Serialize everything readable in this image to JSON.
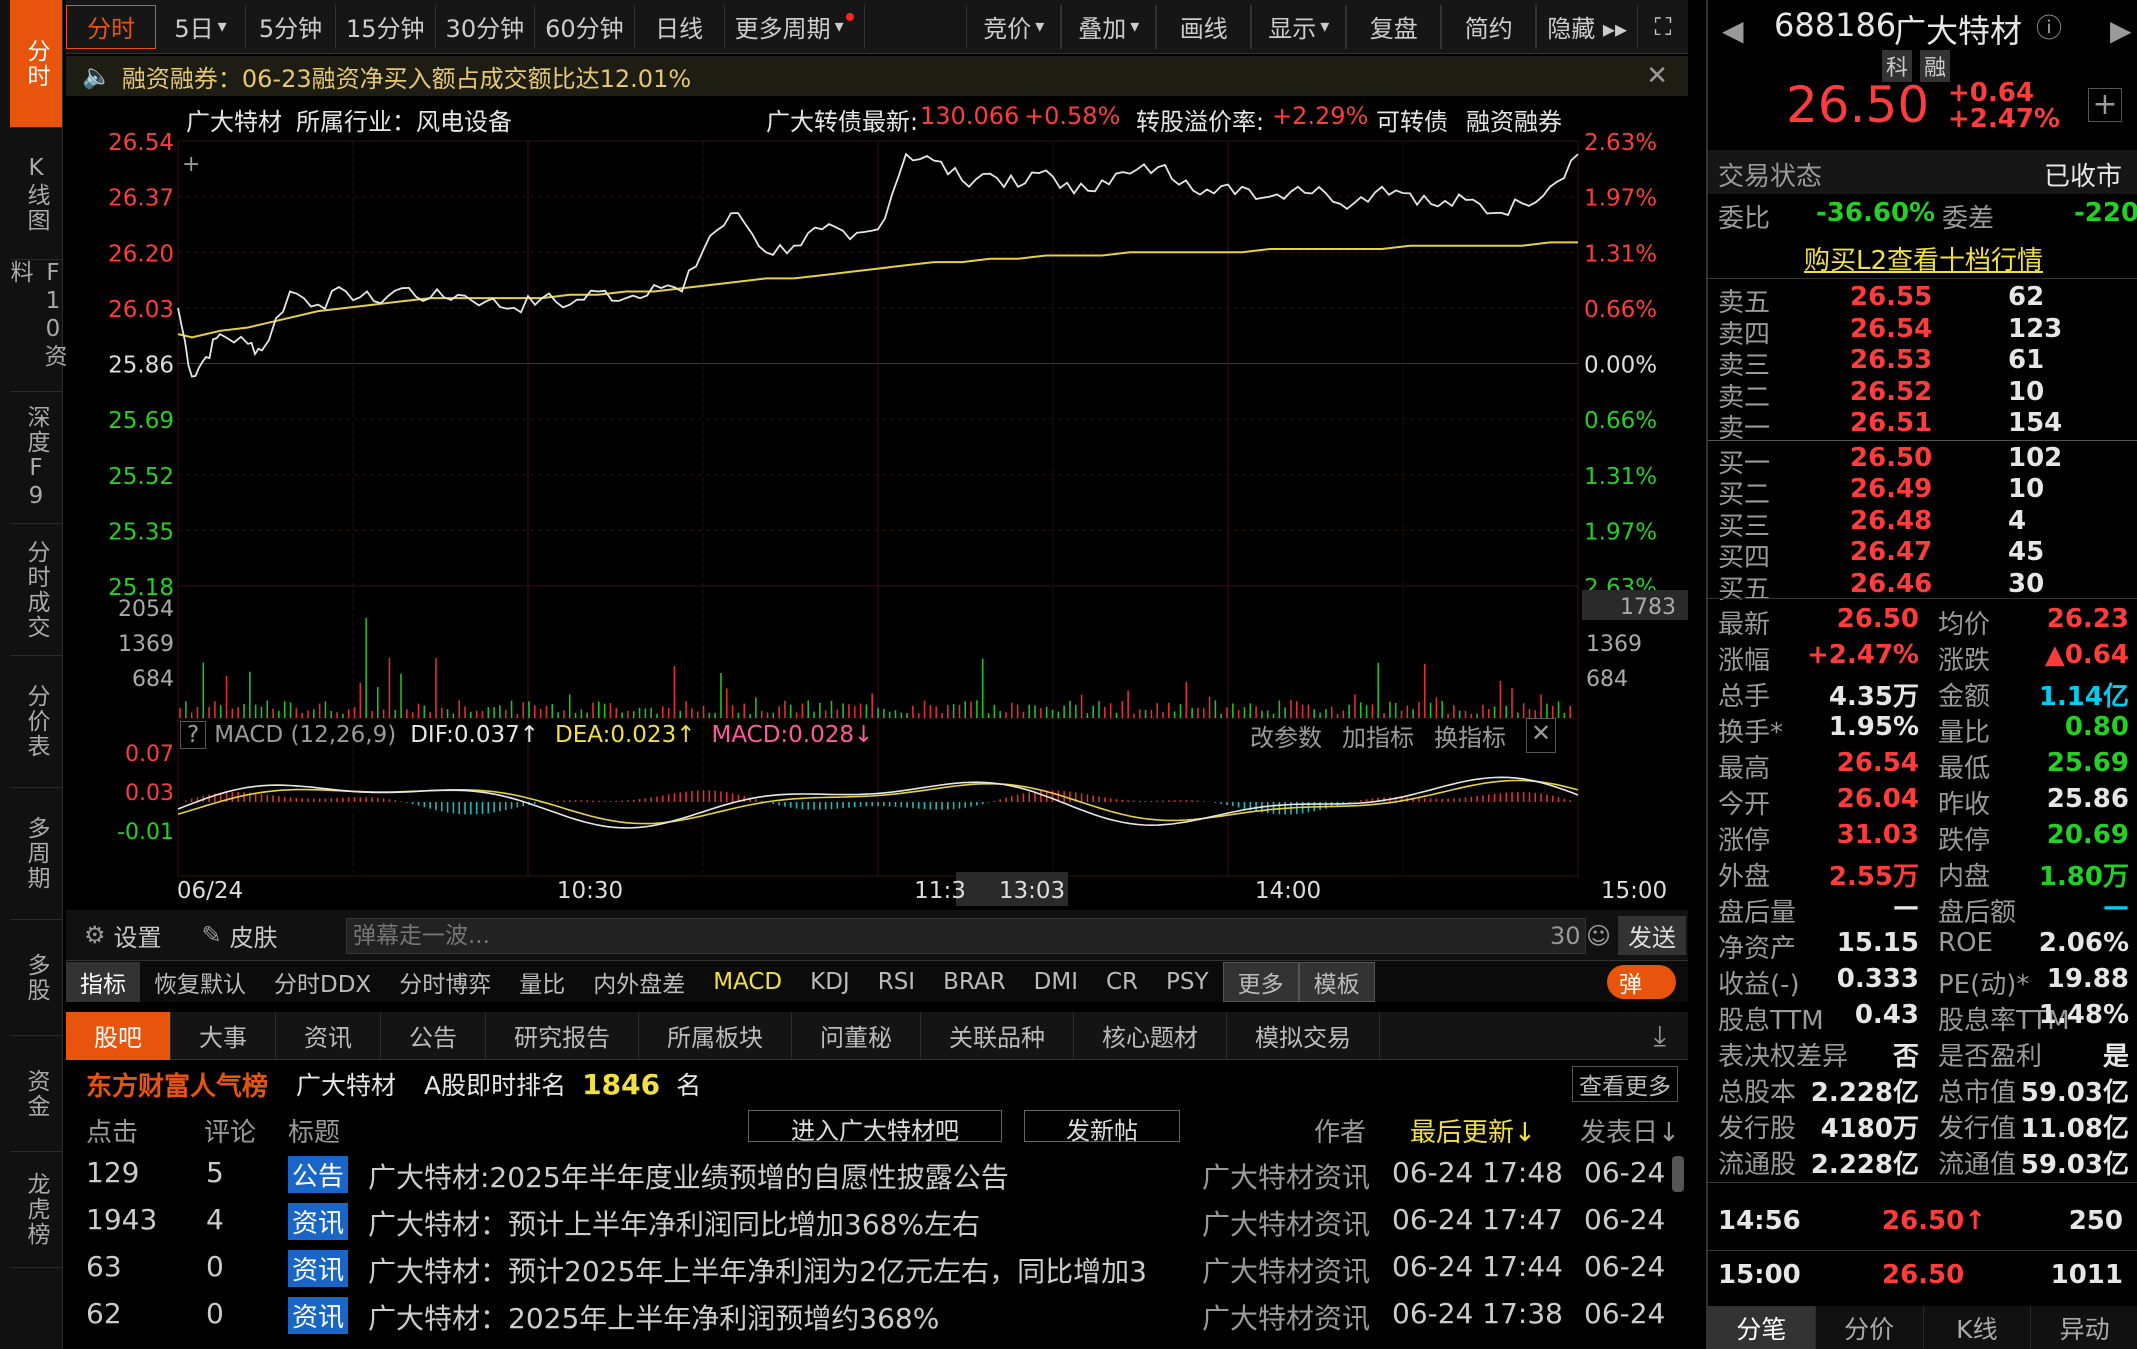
{
  "sidebar": {
    "items": [
      "分时",
      "K线图",
      "F10资料",
      "深度F9",
      "分时成交",
      "分价表",
      "多周期",
      "多股",
      "资金",
      "龙虎榜"
    ]
  },
  "topbar": {
    "tabs": [
      "分时",
      "5日",
      "5分钟",
      "15分钟",
      "30分钟",
      "60分钟",
      "日线",
      "更多周期"
    ],
    "right": [
      "竞价",
      "叠加",
      "画线",
      "显示",
      "复盘",
      "简约",
      "隐藏 ▸▸"
    ]
  },
  "news": {
    "text": "融资融券：06-23融资净买入额占成交额比达12.01%"
  },
  "info": {
    "name": "广大特材",
    "industry": "所属行业：风电设备",
    "bond": "广大转债最新:",
    "bond_price": "130.066",
    "bond_chg": "+0.58%",
    "premium_label": "转股溢价率:",
    "premium": "+2.29%",
    "cb": "可转债",
    "margin": "融资融券"
  },
  "chart_data": {
    "type": "line",
    "x_labels": [
      "06/24",
      "10:30",
      "11:3",
      "13:03",
      "14:00",
      "15:00"
    ],
    "y_left": [
      "26.54",
      "26.37",
      "26.20",
      "26.03",
      "25.86",
      "25.69",
      "25.52",
      "25.35",
      "25.18"
    ],
    "y_right": [
      "2.63%",
      "1.97%",
      "1.31%",
      "0.66%",
      "0.00%",
      "0.66%",
      "1.31%",
      "1.97%",
      "2.63%"
    ],
    "prev_close": 25.86,
    "ylim": [
      25.18,
      26.54
    ],
    "price_x": [
      0,
      0.01,
      0.02,
      0.03,
      0.05,
      0.06,
      0.08,
      0.1,
      0.12,
      0.14,
      0.16,
      0.18,
      0.2,
      0.22,
      0.24,
      0.26,
      0.28,
      0.3,
      0.32,
      0.34,
      0.36,
      0.38,
      0.4,
      0.42,
      0.44,
      0.46,
      0.48,
      0.5,
      0.52,
      0.54,
      0.56,
      0.58,
      0.6,
      0.62,
      0.64,
      0.66,
      0.68,
      0.7,
      0.72,
      0.74,
      0.76,
      0.78,
      0.8,
      0.82,
      0.84,
      0.86,
      0.88,
      0.9,
      0.92,
      0.94,
      0.96,
      0.98,
      1.0
    ],
    "price": [
      26.03,
      25.82,
      25.88,
      25.95,
      25.92,
      25.9,
      26.08,
      26.04,
      26.08,
      26.05,
      26.09,
      26.06,
      26.07,
      26.05,
      26.03,
      26.06,
      26.04,
      26.08,
      26.06,
      26.1,
      26.08,
      26.25,
      26.32,
      26.2,
      26.22,
      26.27,
      26.24,
      26.27,
      26.5,
      26.48,
      26.42,
      26.44,
      26.4,
      26.45,
      26.38,
      26.42,
      26.44,
      26.46,
      26.42,
      26.38,
      26.4,
      26.37,
      26.4,
      26.38,
      26.35,
      26.4,
      26.38,
      26.34,
      26.36,
      26.32,
      26.35,
      26.4,
      26.5
    ],
    "avg": [
      25.95,
      25.94,
      25.95,
      25.96,
      25.97,
      25.98,
      26.0,
      26.02,
      26.03,
      26.04,
      26.05,
      26.06,
      26.06,
      26.06,
      26.06,
      26.06,
      26.07,
      26.07,
      26.08,
      26.08,
      26.09,
      26.1,
      26.11,
      26.12,
      26.12,
      26.13,
      26.14,
      26.15,
      26.16,
      26.17,
      26.17,
      26.18,
      26.18,
      26.19,
      26.19,
      26.19,
      26.2,
      26.2,
      26.2,
      26.2,
      26.2,
      26.21,
      26.21,
      26.21,
      26.21,
      26.21,
      26.22,
      26.22,
      26.22,
      26.22,
      26.22,
      26.23,
      26.23
    ],
    "volume_axis": [
      "2054",
      "1369",
      "684"
    ],
    "volume_right": [
      "1783",
      "1369",
      "684"
    ],
    "macd_axis": [
      "0.07",
      "0.03",
      "-0.01"
    ]
  },
  "macd": {
    "name": "MACD (12,26,9)",
    "dif": "DIF:0.037↑",
    "dea": "DEA:0.023↑",
    "macd": "MACD:0.028↓",
    "btns": [
      "改参数",
      "加指标",
      "换指标"
    ]
  },
  "tools": {
    "settings": "设置",
    "skin": "皮肤",
    "danmu_placeholder": "弹幕走一波...",
    "count": "30",
    "send": "发送"
  },
  "indicators": [
    "指标",
    "恢复默认",
    "分时DDX",
    "分时博弈",
    "量比",
    "内外盘差",
    "MACD",
    "KDJ",
    "RSI",
    "BRAR",
    "DMI",
    "CR",
    "PSY",
    "更多",
    "模板",
    "弹"
  ],
  "ftabs": [
    "股吧",
    "大事",
    "资讯",
    "公告",
    "研究报告",
    "所属板块",
    "问董秘",
    "关联品种",
    "核心题材",
    "模拟交易"
  ],
  "rank": {
    "brand": "东方财富人气榜",
    "name": "广大特材",
    "label": "A股即时排名",
    "value": "1846",
    "unit": "名",
    "more": "查看更多"
  },
  "newshead": {
    "clicks": "点击",
    "comments": "评论",
    "title": "标题",
    "enter": "进入广大特材吧",
    "post": "发新帖",
    "author": "作者",
    "updated": "最后更新↓",
    "published": "发表日↓"
  },
  "newsrows": [
    {
      "clicks": "129",
      "comments": "5",
      "tag": "公告",
      "title": "广大特材:2025年半年度业绩预增的自愿性披露公告",
      "author": "广大特材资讯",
      "updated": "06-24 17:48",
      "date": "06-24"
    },
    {
      "clicks": "1943",
      "comments": "4",
      "tag": "资讯",
      "title": "广大特材：预计上半年净利润同比增加368%左右",
      "author": "广大特材资讯",
      "updated": "06-24 17:47",
      "date": "06-24"
    },
    {
      "clicks": "63",
      "comments": "0",
      "tag": "资讯",
      "title": "广大特材：预计2025年上半年净利润为2亿元左右，同比增加3",
      "author": "广大特材资讯",
      "updated": "06-24 17:44",
      "date": "06-24"
    },
    {
      "clicks": "62",
      "comments": "0",
      "tag": "资讯",
      "title": "广大特材：2025年上半年净利润预增约368%",
      "author": "广大特材资讯",
      "updated": "06-24 17:38",
      "date": "06-24"
    }
  ],
  "quote": {
    "code": "688186",
    "name": "广大特材",
    "tags": [
      "科",
      "融"
    ],
    "price": "26.50",
    "chg": "+0.64",
    "pct": "+2.47%",
    "status_label": "交易状态",
    "status": "已收市",
    "wb_label": "委比",
    "wb": "-36.60%",
    "wc_label": "委差",
    "wc": "-220",
    "l2": "购买L2查看十档行情"
  },
  "asks": [
    {
      "l": "卖五",
      "p": "26.55",
      "v": "62"
    },
    {
      "l": "卖四",
      "p": "26.54",
      "v": "123"
    },
    {
      "l": "卖三",
      "p": "26.53",
      "v": "61"
    },
    {
      "l": "卖二",
      "p": "26.52",
      "v": "10"
    },
    {
      "l": "卖一",
      "p": "26.51",
      "v": "154"
    }
  ],
  "bids": [
    {
      "l": "买一",
      "p": "26.50",
      "v": "102"
    },
    {
      "l": "买二",
      "p": "26.49",
      "v": "10"
    },
    {
      "l": "买三",
      "p": "26.48",
      "v": "4"
    },
    {
      "l": "买四",
      "p": "26.47",
      "v": "45"
    },
    {
      "l": "买五",
      "p": "26.46",
      "v": "30"
    }
  ],
  "stats": [
    [
      "最新",
      "26.50",
      "均价",
      "26.23"
    ],
    [
      "涨幅",
      "+2.47%",
      "涨跌",
      "▲0.64"
    ],
    [
      "总手",
      "4.35万",
      "金额",
      "1.14亿"
    ],
    [
      "换手*",
      "1.95%",
      "量比",
      "0.80"
    ],
    [
      "最高",
      "26.54",
      "最低",
      "25.69"
    ],
    [
      "今开",
      "26.04",
      "昨收",
      "25.86"
    ],
    [
      "涨停",
      "31.03",
      "跌停",
      "20.69"
    ],
    [
      "外盘",
      "2.55万",
      "内盘",
      "1.80万"
    ],
    [
      "盘后量",
      "—",
      "盘后额",
      "—"
    ],
    [
      "净资产",
      "15.15",
      "ROE",
      "2.06%"
    ],
    [
      "收益(-)",
      "0.333",
      "PE(动)*",
      "19.88"
    ],
    [
      "股息TTM",
      "0.43",
      "股息率TTM",
      "1.48%"
    ],
    [
      "表决权差异",
      "否",
      "是否盈利",
      "是"
    ],
    [
      "总股本",
      "2.228亿",
      "总市值",
      "59.03亿"
    ],
    [
      "发行股",
      "4180万",
      "发行值",
      "11.08亿"
    ],
    [
      "流通股",
      "2.228亿",
      "流通值",
      "59.03亿"
    ]
  ],
  "trades": [
    {
      "t": "14:56",
      "p": "26.50↑",
      "v": "250"
    },
    {
      "t": "15:00",
      "p": "26.50",
      "v": "1011"
    }
  ],
  "rtabs": [
    "分笔",
    "分价",
    "K线",
    "异动"
  ]
}
